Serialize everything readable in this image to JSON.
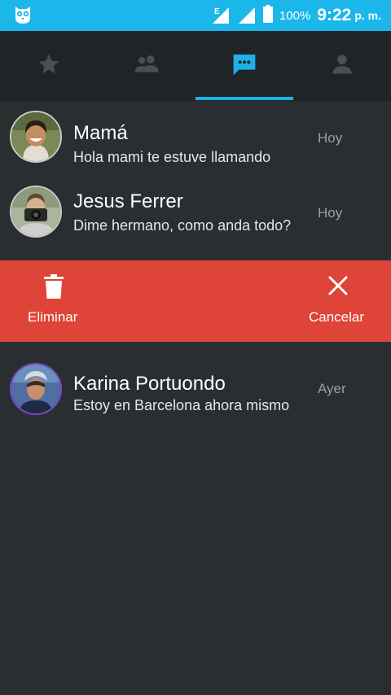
{
  "status_bar": {
    "app_icon": "owl-icon",
    "network_letter": "E",
    "battery_percent": "100%",
    "time": "9:22",
    "ampm": "p. m."
  },
  "tabs": [
    {
      "icon": "star-icon",
      "selected": false
    },
    {
      "icon": "people-icon",
      "selected": false
    },
    {
      "icon": "chat-icon",
      "selected": true
    },
    {
      "icon": "person-icon",
      "selected": false
    }
  ],
  "colors": {
    "status_bar": "#1bb7ea",
    "accent": "#1ab2e8",
    "background": "#2b2e31",
    "tab_bar": "#212427",
    "swipe_bg": "#de4437"
  },
  "conversations": [
    {
      "name": "Mamá",
      "message": "Hola mami te estuve llamando",
      "date": "Hoy"
    },
    {
      "name": "Jesus Ferrer",
      "message": "Dime hermano, como anda todo?",
      "date": "Hoy"
    },
    {
      "name": "Karina Portuondo",
      "message": "Estoy en Barcelona ahora mismo",
      "date": "Ayer"
    }
  ],
  "swipe_actions": {
    "delete_label": "Eliminar",
    "cancel_label": "Cancelar"
  }
}
